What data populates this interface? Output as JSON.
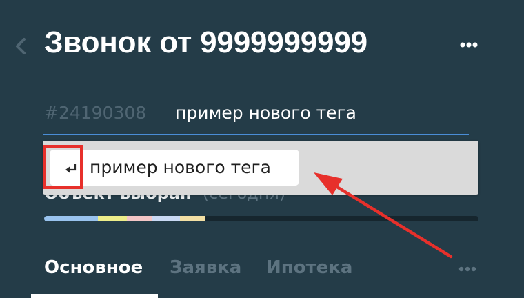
{
  "header": {
    "title": "Звонок от 9999999999"
  },
  "tag_input": {
    "deal_id": "#24190308",
    "value": "пример нового тега"
  },
  "suggestion": {
    "label": "пример нового тега"
  },
  "under_dropdown": {
    "status_text": "Объект выбран",
    "status_hint": "(сегодня)"
  },
  "progress": {
    "segments": [
      {
        "color": "#99c3ee",
        "fraction": 0.124
      },
      {
        "color": "#eded8a",
        "fraction": 0.067
      },
      {
        "color": "#f3c6c6",
        "fraction": 0.056
      },
      {
        "color": "#c9d9f3",
        "fraction": 0.065
      },
      {
        "color": "#f2dfa4",
        "fraction": 0.06
      }
    ]
  },
  "tabs": [
    {
      "label": "Основное",
      "active": true
    },
    {
      "label": "Заявка",
      "active": false
    },
    {
      "label": "Ипотека",
      "active": false
    }
  ],
  "colors": {
    "background": "#243c48",
    "annotation": "#e7302b",
    "input_underline": "#4a8dd6"
  },
  "icons": {
    "back": "chevron-left-icon",
    "more": "ellipsis-icon",
    "enter": "enter-return-icon"
  }
}
